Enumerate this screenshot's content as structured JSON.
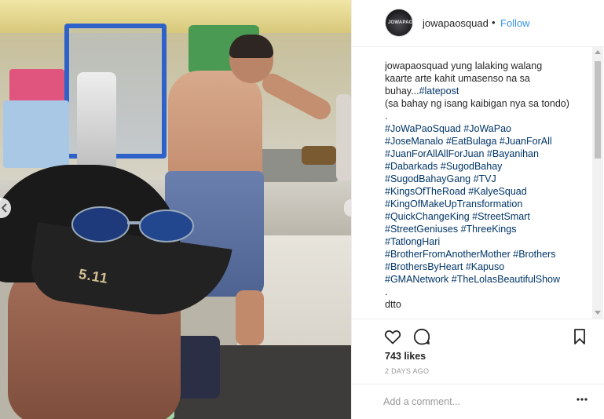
{
  "post": {
    "username": "jowapaosquad",
    "separator": "•",
    "follow_label": "Follow",
    "avatar_text": "JOWAPAO",
    "caption_user": "jowapaosquad",
    "caption_lines": [
      "yung lalaking walang",
      "kaarte arte kahit umasenso na sa",
      "buhay..."
    ],
    "caption_latepost": "#latepost",
    "caption_note": "(sa bahay ng isang kaibigan nya sa tondo)",
    "caption_dot": ".",
    "hashtag_lines": [
      "#JoWaPaoSquad #JoWaPao",
      "#JoseManalo #EatBulaga #JuanForAll",
      "#JuanForAllAllForJuan #Bayanihan",
      "#Dabarkads #SugodBahay",
      "#SugodBahayGang #TVJ",
      "#KingsOfTheRoad #KalyeSquad",
      "#KingOfMakeUpTransformation",
      "#QuickChangeKing #StreetSmart",
      "#StreetGeniuses #ThreeKings",
      "#TatlongHari",
      "#BrotherFromAnotherMother #Brothers",
      "#BrothersByHeart #Kapuso",
      "#GMANetwork #TheLolasBeautifulShow"
    ],
    "caption_tail": [
      ".",
      "dtto"
    ],
    "likes": "743 likes",
    "time": "2 DAYS AGO",
    "comment_placeholder": "Add a comment..."
  },
  "photo": {
    "cap_logo": "5.11"
  },
  "icons": {
    "heart": "heart-icon",
    "comment": "comment-icon",
    "bookmark": "bookmark-icon",
    "more": "more-icon",
    "prev": "chevron-left-icon"
  },
  "colors": {
    "link": "#3897f0",
    "hashtag": "#003569",
    "text": "#262626",
    "muted": "#999999"
  }
}
